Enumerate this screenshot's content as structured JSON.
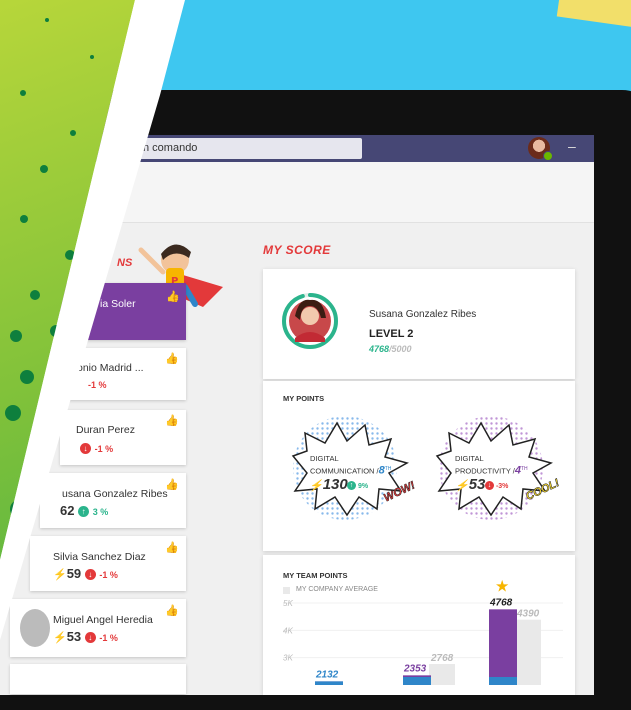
{
  "search": {
    "placeholder_fragment": "n comando"
  },
  "leaderboard": {
    "title_fragment": "NS",
    "items": [
      {
        "name": "ia Soler",
        "highlight": true
      },
      {
        "name": "onio Madrid ...",
        "change": "-1 %",
        "dir": "down"
      },
      {
        "name": "Duran Perez",
        "change": "-1 %",
        "dir": "down"
      },
      {
        "name": "usana Gonzalez Ribes",
        "score": "62",
        "change": "3 %",
        "dir": "up"
      },
      {
        "name": "Silvia Sanchez Diaz",
        "score": "59",
        "change": "-1 %",
        "dir": "down"
      },
      {
        "name": "Miguel Angel Heredia",
        "score": "53",
        "change": "-1 %",
        "dir": "down"
      }
    ]
  },
  "my_score": {
    "title": "MY SCORE",
    "user_name": "Susana Gonzalez Ribes",
    "level": "LEVEL 2",
    "points_current": "4768",
    "points_max": "/5000",
    "progress": 0.9536
  },
  "my_points": {
    "title": "MY POINTS",
    "cards": [
      {
        "label_1": "DIGITAL",
        "label_2": "COMMUNICATION /",
        "rank": "8",
        "rank_sup": "TH",
        "value": "130",
        "change": "9%",
        "dir": "up",
        "exclaim": "WOW!"
      },
      {
        "label_1": "DIGITAL",
        "label_2": "PRODUCTIVITY /",
        "rank": "4",
        "rank_sup": "TH",
        "value": "53",
        "change": "-3%",
        "dir": "down",
        "exclaim": "COOL!"
      }
    ]
  },
  "team_points": {
    "title": "MY TEAM POINTS",
    "legend": "MY COMPANY AVERAGE"
  },
  "chart_data": {
    "type": "bar",
    "title": "MY TEAM POINTS",
    "ylim": [
      2000,
      5000
    ],
    "y_ticks": [
      "5K",
      "4K",
      "3K"
    ],
    "series": [
      {
        "name": "team",
        "values": [
          2132,
          2353,
          4768
        ]
      },
      {
        "name": "MY COMPANY AVERAGE",
        "values": [
          null,
          2768,
          4390
        ]
      }
    ],
    "colors": {
      "team": "#7a3fa0",
      "average": "#e9e9e9",
      "accent": "#2f86c9"
    }
  },
  "colors": {
    "accent_purple": "#7a3fa0",
    "teams_bar": "#464775",
    "red": "#e3393a",
    "green": "#2bb48c"
  }
}
